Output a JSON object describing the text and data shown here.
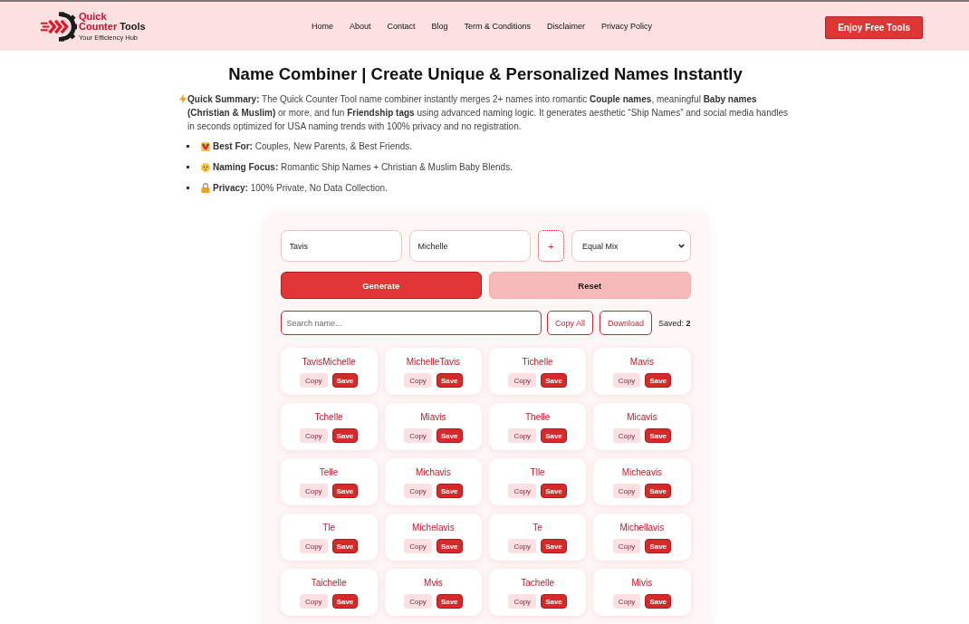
{
  "header": {
    "logo": {
      "name_lines": [
        "Quick",
        "Counter"
      ],
      "name_end": "Tools",
      "tagline": "Your Efficiency Hub"
    },
    "nav": [
      "Home",
      "About",
      "Contact",
      "Blog",
      "Term & Conditions",
      "Disclaimer",
      "Privacy Policy"
    ],
    "cta": "Enjoy Free Tools"
  },
  "intro": {
    "title": "Name Combiner | Create Unique & Personalized Names Instantly",
    "summary": "**Quick Summary:** The Quick Counter Tool name combiner instantly merges 2+ names into romantic **Couple names**, meaningful **Baby names (Christian & Muslim)** or more, and fun **Friendship tags** using advanced naming logic. It generates aesthetic “Ship Names” and social media handles in seconds optimized for USA naming trends with 100% privacy and no registration.",
    "highlights": [
      "**Best For:** Couples, New Parents, & Best Friends.",
      "**Naming Focus:** Romantic Ship Names + Christian & Muslim Baby Blends.",
      "**Privacy:** 100% Private, No Data Collection."
    ]
  },
  "tool": {
    "name_inputs": [
      {
        "value": "Tavis"
      },
      {
        "value": "Michelle"
      }
    ],
    "add_button": "+",
    "mix_select": {
      "value": "Equal Mix"
    },
    "generate_button": "Generate",
    "reset_button": "Reset",
    "search": {
      "placeholder": "Search name..."
    },
    "copy_all_button": "Copy All",
    "download_button": "Download",
    "saved_count": "Saved: **2**",
    "results": [
      {
        "name": "TavisMichelle",
        "copy": "Copy",
        "save": "Save"
      },
      {
        "name": "MichelleTavis",
        "copy": "Copy",
        "save": "Save"
      },
      {
        "name": "Tichelle",
        "copy": "Copy",
        "save": "Save"
      },
      {
        "name": "Mavis",
        "copy": "Copy",
        "save": "Save"
      },
      {
        "name": "Tchelle",
        "copy": "Copy",
        "save": "Save"
      },
      {
        "name": "Miavis",
        "copy": "Copy",
        "save": "Save"
      },
      {
        "name": "Thelle",
        "copy": "Copy",
        "save": "Save"
      },
      {
        "name": "Micavis",
        "copy": "Copy",
        "save": "Save"
      },
      {
        "name": "Telle",
        "copy": "Copy",
        "save": "Save"
      },
      {
        "name": "Michavis",
        "copy": "Copy",
        "save": "Save"
      },
      {
        "name": "Tlle",
        "copy": "Copy",
        "save": "Save"
      },
      {
        "name": "Micheavis",
        "copy": "Copy",
        "save": "Save"
      },
      {
        "name": "Tle",
        "copy": "Copy",
        "save": "Save"
      },
      {
        "name": "Michelavis",
        "copy": "Copy",
        "save": "Save"
      },
      {
        "name": "Te",
        "copy": "Copy",
        "save": "Save"
      },
      {
        "name": "Michellavis",
        "copy": "Copy",
        "save": "Save"
      },
      {
        "name": "Taichelle",
        "copy": "Copy",
        "save": "Save"
      },
      {
        "name": "Mvis",
        "copy": "Copy",
        "save": "Save"
      },
      {
        "name": "Tachelle",
        "copy": "Copy",
        "save": "Save"
      },
      {
        "name": "Mivis",
        "copy": "Copy",
        "save": "Save"
      }
    ]
  }
}
